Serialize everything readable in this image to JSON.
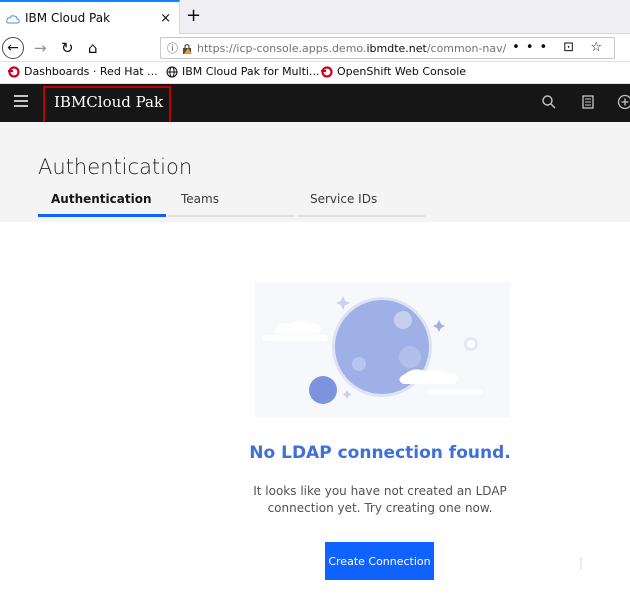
{
  "browser": {
    "tab_title": "IBM Cloud Pak",
    "tab_close": "×",
    "new_tab": "+",
    "url_prefix": "https://icp-console.apps.demo.",
    "url_domain": "ibmdte.net",
    "url_suffix": "/common-nav/ident",
    "url_actions": "••• ⊡ ☆",
    "bookmarks": [
      {
        "label": "Dashboards · Red Hat ...",
        "icon": "openshift-icon"
      },
      {
        "label": "IBM Cloud Pak for Multi...",
        "icon": "globe-icon"
      },
      {
        "label": "OpenShift Web Console",
        "icon": "openshift-icon"
      }
    ]
  },
  "app": {
    "brand": "IBMCloud Pak",
    "accent_color": "#0f62fe",
    "header_icons": [
      "search-icon",
      "catalog-icon",
      "add-icon"
    ]
  },
  "page": {
    "title": "Authentication",
    "tabs": [
      {
        "label": "Authentication",
        "active": true
      },
      {
        "label": "Teams",
        "active": false
      },
      {
        "label": "Service IDs",
        "active": false
      }
    ]
  },
  "empty_state": {
    "title": "No LDAP connection found.",
    "description": "It looks like you have not created an LDAP connection yet. Try creating one now.",
    "button_label": "Create Connection"
  }
}
